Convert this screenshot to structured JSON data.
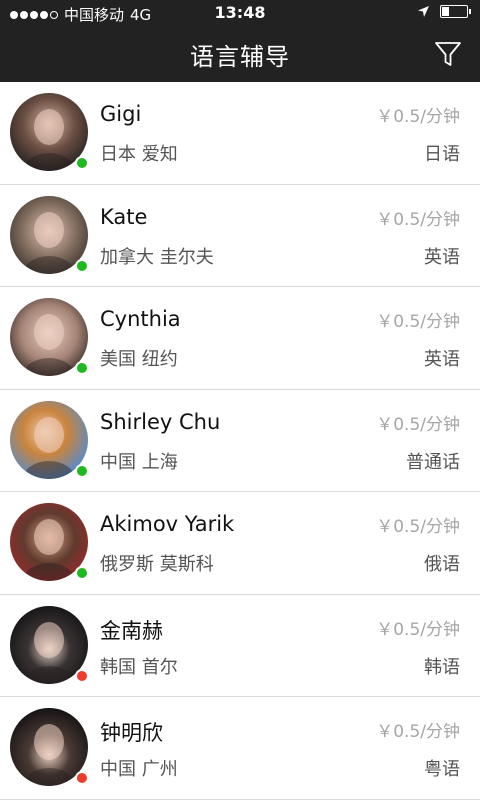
{
  "status_bar": {
    "carrier": "中国移动",
    "network": "4G",
    "time": "13:48",
    "battery_level": 0.3
  },
  "header": {
    "title": "语言辅导",
    "filter_icon": "filter-icon"
  },
  "colors": {
    "online": "#1fb81f",
    "offline": "#ee3b2b",
    "header_bg": "#222222"
  },
  "tutors": [
    {
      "name": "Gigi",
      "location": "日本 爱知",
      "price": "￥0.5/分钟",
      "language": "日语",
      "online": true
    },
    {
      "name": "Kate",
      "location": "加拿大 圭尔夫",
      "price": "￥0.5/分钟",
      "language": "英语",
      "online": true
    },
    {
      "name": "Cynthia",
      "location": "美国 纽约",
      "price": "￥0.5/分钟",
      "language": "英语",
      "online": true
    },
    {
      "name": "Shirley Chu",
      "location": "中国 上海",
      "price": "￥0.5/分钟",
      "language": "普通话",
      "online": true
    },
    {
      "name": "Akimov Yarik",
      "location": "俄罗斯 莫斯科",
      "price": "￥0.5/分钟",
      "language": "俄语",
      "online": true
    },
    {
      "name": "金南赫",
      "location": "韩国 首尔",
      "price": "￥0.5/分钟",
      "language": "韩语",
      "online": false
    },
    {
      "name": "钟明欣",
      "location": "中国 广州",
      "price": "￥0.5/分钟",
      "language": "粤语",
      "online": false
    }
  ]
}
